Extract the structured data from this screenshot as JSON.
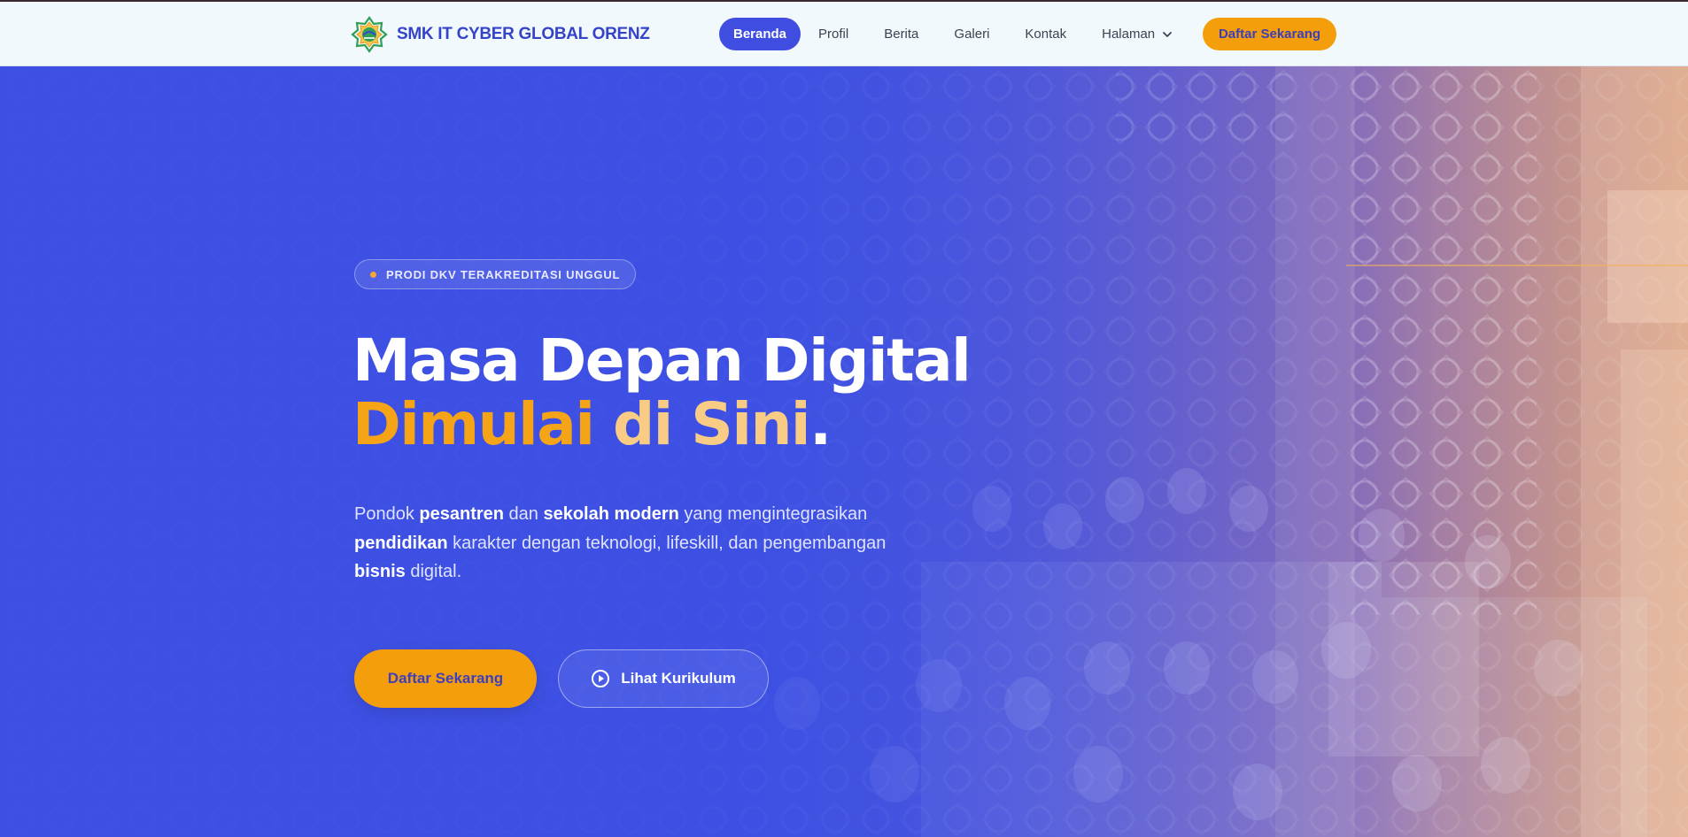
{
  "brand": {
    "name": "SMK IT CYBER GLOBAL ORENZ",
    "logo_icon": "star-emblem-logo-icon"
  },
  "nav": {
    "items": [
      {
        "label": "Beranda",
        "active": true
      },
      {
        "label": "Profil"
      },
      {
        "label": "Berita"
      },
      {
        "label": "Galeri"
      },
      {
        "label": "Kontak"
      },
      {
        "label": "Halaman",
        "icon": "chevron-down-icon"
      }
    ],
    "cta_label": "Daftar Sekarang"
  },
  "hero": {
    "badge": "PRODI DKV TERAKREDITASI UNGGUL",
    "title_line1": "Masa Depan Digital",
    "title_line2_a": "Dimulai",
    "title_line2_b": "di Sini",
    "title_line2_dot": ".",
    "lead": {
      "t1": "Pondok ",
      "b1": "pesantren",
      "t2": " dan ",
      "b2": "sekolah modern",
      "t3": " yang mengintegrasikan ",
      "b3": "pendidikan",
      "t4": " karakter dengan teknologi, lifeskill, dan pengembangan ",
      "b4": "bisnis",
      "t5": " digital."
    },
    "primary_button": "Daftar Sekarang",
    "secondary_button": "Lihat Kurikulum",
    "secondary_icon": "play-circle-icon"
  },
  "colors": {
    "primary": "#3f4ee0",
    "accent": "#f59e0b",
    "accent_light": "#f9cc85",
    "nav_bg": "#f2f9fd"
  }
}
